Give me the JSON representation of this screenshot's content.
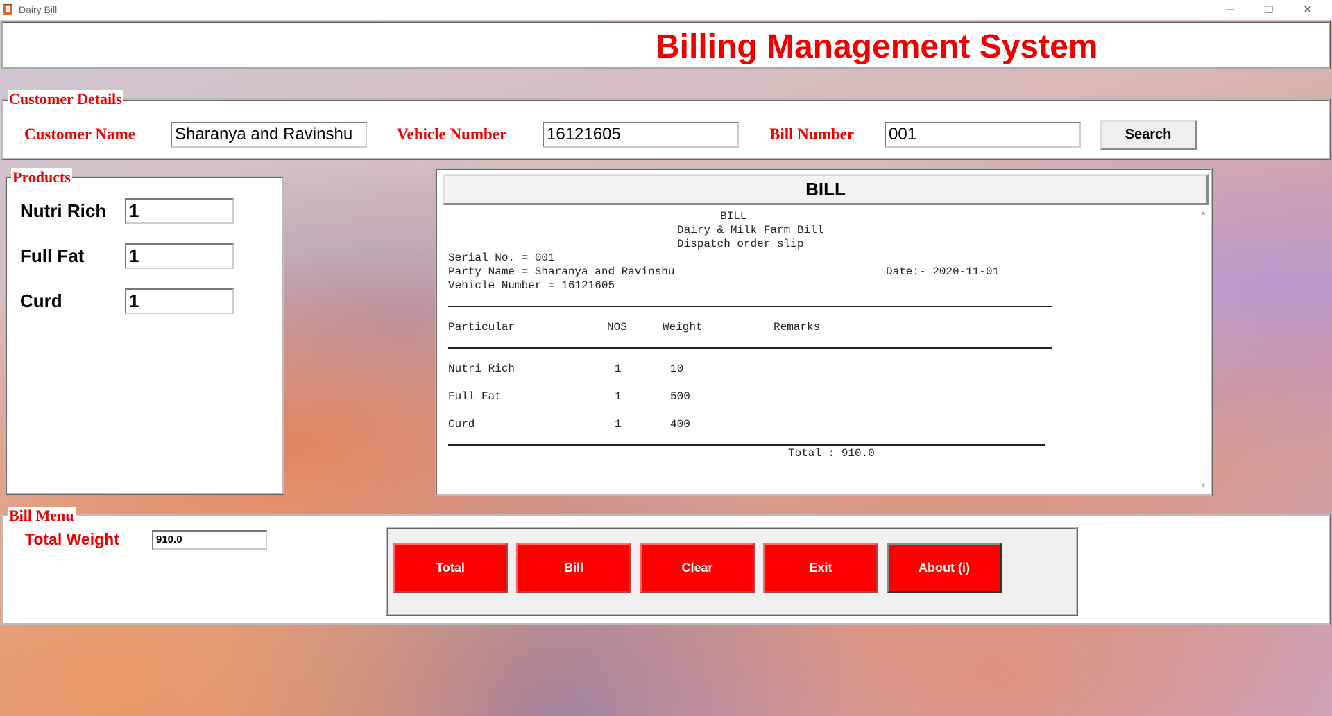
{
  "window": {
    "title": "Dairy Bill",
    "minimize": "─",
    "restore": "❐",
    "close": "✕"
  },
  "header": {
    "title": "Billing Management System"
  },
  "customer_details": {
    "legend": "Customer Details",
    "customer_name_label": "Customer Name",
    "customer_name_value": "Sharanya and Ravinshu",
    "vehicle_number_label": "Vehicle Number",
    "vehicle_number_value": "16121605",
    "bill_number_label": "Bill Number",
    "bill_number_value": "001",
    "search_label": "Search"
  },
  "products": {
    "legend": "Products",
    "items": [
      {
        "label": "Nutri Rich",
        "value": "1"
      },
      {
        "label": "Full Fat",
        "value": "1"
      },
      {
        "label": "Curd",
        "value": "1"
      }
    ]
  },
  "bill": {
    "header": "BILL",
    "lines": {
      "l1": "BILL",
      "l2": "Dairy & Milk Farm Bill",
      "l3": "Dispatch order slip",
      "serial": "Serial No. = 001",
      "party": "Party Name = Sharanya and Ravinshu",
      "date": "Date:- 2020-11-01",
      "vehicle": "Vehicle Number = 16121605"
    },
    "columns": [
      "Particular",
      "NOS",
      "Weight",
      "Remarks"
    ],
    "rows": [
      {
        "particular": "Nutri Rich",
        "nos": "1",
        "weight": "10"
      },
      {
        "particular": "Full Fat",
        "nos": "1",
        "weight": "500"
      },
      {
        "particular": "Curd",
        "nos": "1",
        "weight": "400"
      }
    ],
    "total": "Total : 910.0"
  },
  "bill_menu": {
    "legend": "Bill Menu",
    "total_weight_label": "Total Weight",
    "total_weight_value": "910.0",
    "buttons": {
      "total": "Total",
      "bill": "Bill",
      "clear": "Clear",
      "exit": "Exit",
      "about": "About (i)"
    }
  },
  "colors": {
    "accent": "#ee0000",
    "button_red": "#ff0000"
  }
}
